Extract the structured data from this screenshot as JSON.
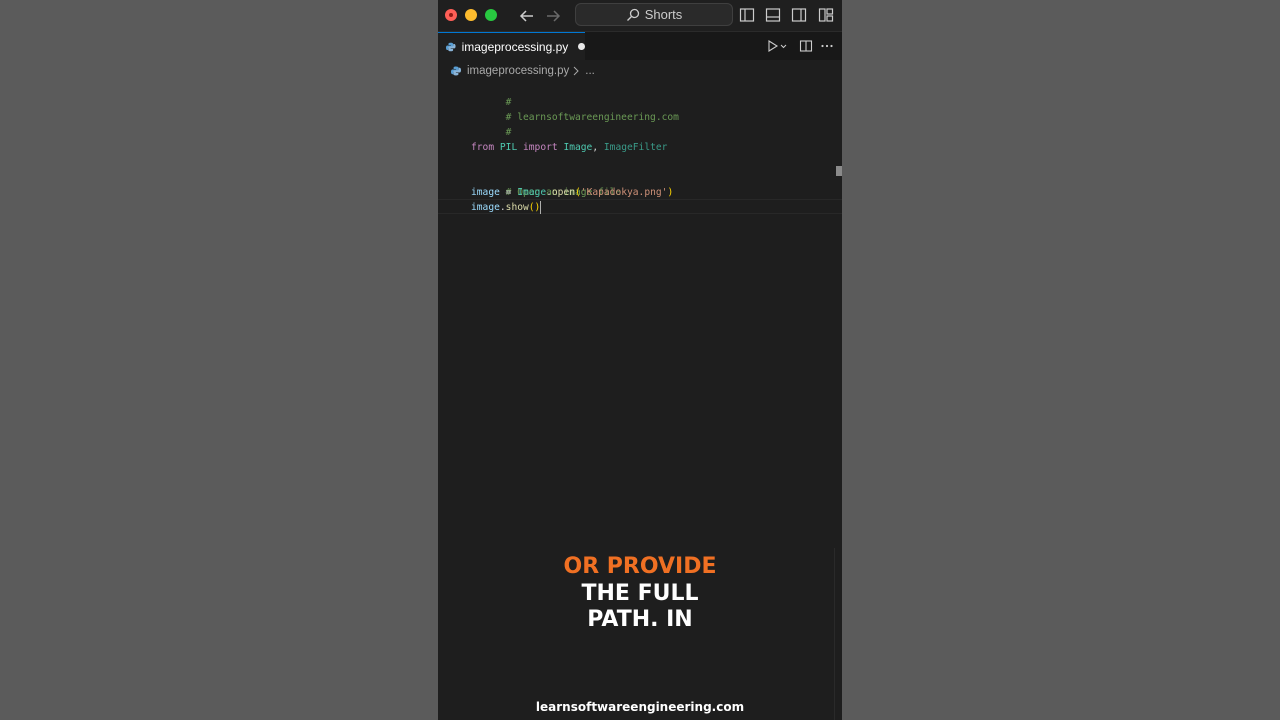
{
  "search": {
    "label": "Shorts"
  },
  "tab": {
    "filename": "imageprocessing.py"
  },
  "breadcrumb": {
    "file": "imageprocessing.py",
    "ellipsis": "..."
  },
  "code": {
    "line1": "#",
    "line2": "# learnsoftwareengineering.com",
    "line3": "#",
    "line5": {
      "from": "from",
      "module": "PIL",
      "import": "import",
      "cls1": "Image",
      "comma": ",",
      "cls2": "ImageFilter"
    },
    "line7": "# Open an image file",
    "line8": {
      "var": "image",
      "eq": "=",
      "cls": "Image",
      "dot": ".",
      "fn": "open",
      "lp": "(",
      "str": "'Kapadokya.png'",
      "rp": ")"
    },
    "line9": {
      "var": "image",
      "dot": ".",
      "fn": "show",
      "parens": "()"
    }
  },
  "caption": {
    "line1": "OR PROVIDE",
    "line2": "THE FULL",
    "line3": "PATH. IN"
  },
  "watermark": "learnsoftwareengineering.com",
  "colors": {
    "accent": "#0078d4",
    "caption_orange": "#f07023"
  },
  "icons": [
    "close-light",
    "minimize-light",
    "zoom-light",
    "back-arrow-icon",
    "forward-arrow-icon",
    "search-icon",
    "toggle-primary-sidebar-icon",
    "toggle-panel-icon",
    "toggle-secondary-sidebar-icon",
    "customize-layout-icon",
    "python-file-icon",
    "run-icon",
    "split-editor-icon",
    "more-actions-icon"
  ]
}
